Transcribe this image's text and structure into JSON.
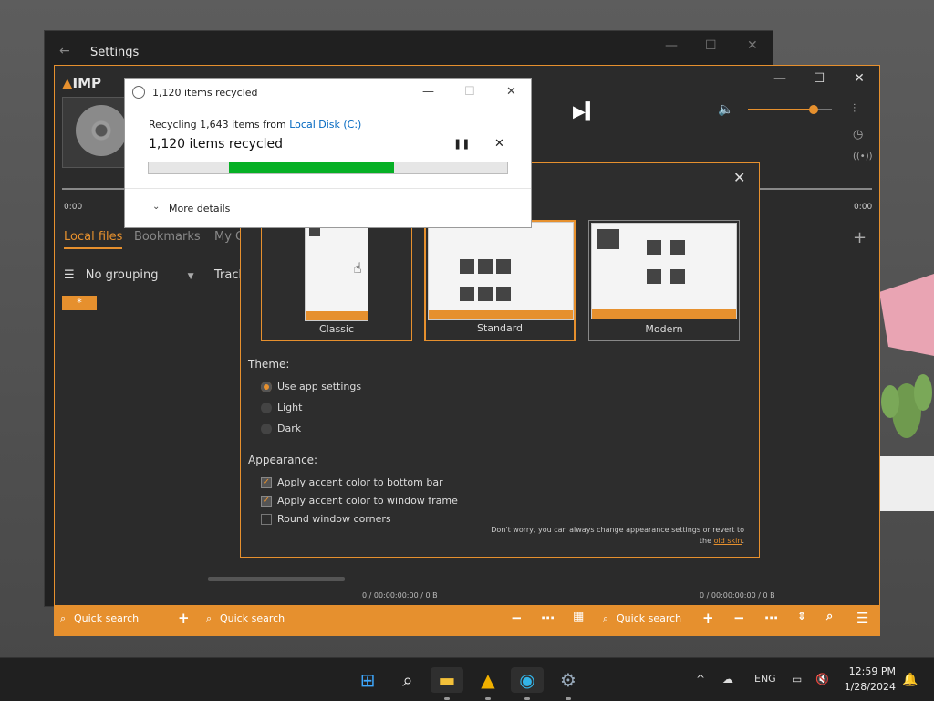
{
  "settings_window": {
    "title": "Settings"
  },
  "aimp": {
    "logo": "IMP",
    "time_left": "0:00",
    "time_right": "0:00",
    "volume_level": 0.78,
    "tabs": [
      {
        "label": "Local files"
      },
      {
        "label": "Bookmarks"
      },
      {
        "label": "My C"
      }
    ],
    "grouping_label": "No grouping",
    "track_header": "Track",
    "playlist_tag": "*",
    "status_left": "0 / 00:00:00:00 / 0 B",
    "status_right": "0 / 00:00:00:00 / 0 B",
    "search_placeholders": [
      "Quick search",
      "Quick search",
      "Quick search"
    ]
  },
  "skin_panel": {
    "cards": [
      {
        "label": "Classic"
      },
      {
        "label": "Standard"
      },
      {
        "label": "Modern"
      }
    ],
    "theme_heading": "Theme:",
    "theme_options": [
      {
        "label": "Use app settings",
        "selected": true
      },
      {
        "label": "Light",
        "selected": false
      },
      {
        "label": "Dark",
        "selected": false
      }
    ],
    "appearance_heading": "Appearance:",
    "appearance_options": [
      {
        "label": "Apply accent color to bottom bar",
        "checked": true
      },
      {
        "label": "Apply accent color to window frame",
        "checked": true
      },
      {
        "label": "Round window corners",
        "checked": false
      }
    ],
    "note_text": "Don't worry, you can always change appearance settings or revert to the",
    "note_link": "old skin",
    "note_end": "."
  },
  "recycle_dialog": {
    "title": "1,120 items recycled",
    "line1_prefix": "Recycling 1,643 items from ",
    "line1_link": "Local Disk (C:)",
    "line2": "1,120 items recycled",
    "more_details": "More details",
    "progress_fraction": 0.68
  },
  "taskbar": {
    "language": "ENG",
    "time": "12:59 PM",
    "date": "1/28/2024"
  },
  "colors": {
    "accent": "#e6902e",
    "progress": "#06b025",
    "link": "#0067c0"
  }
}
